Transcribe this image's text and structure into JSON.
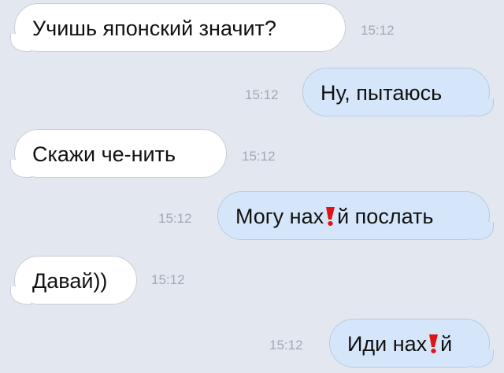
{
  "chat": {
    "messages": [
      {
        "direction": "incoming",
        "text": "Учишь японский значит?",
        "time": "15:12"
      },
      {
        "direction": "outgoing",
        "text": "Ну, пытаюсь",
        "time": "15:12"
      },
      {
        "direction": "incoming",
        "text": "Скажи че-нить",
        "time": "15:12"
      },
      {
        "direction": "outgoing",
        "text_before": "Могу нах",
        "text_after": "й послать",
        "time": "15:12"
      },
      {
        "direction": "incoming",
        "text": "Давай))",
        "time": "15:12"
      },
      {
        "direction": "outgoing",
        "text_before": "Иди нах",
        "text_after": "й",
        "time": "15:12"
      }
    ]
  },
  "colors": {
    "background": "#e3e8f0",
    "incoming_bubble": "#ffffff",
    "outgoing_bubble": "#d6e6fa",
    "timestamp": "#a2a8b2",
    "censor_mark": "#e01414"
  },
  "icons": {
    "censor": "red-exclamation-censor-icon"
  }
}
